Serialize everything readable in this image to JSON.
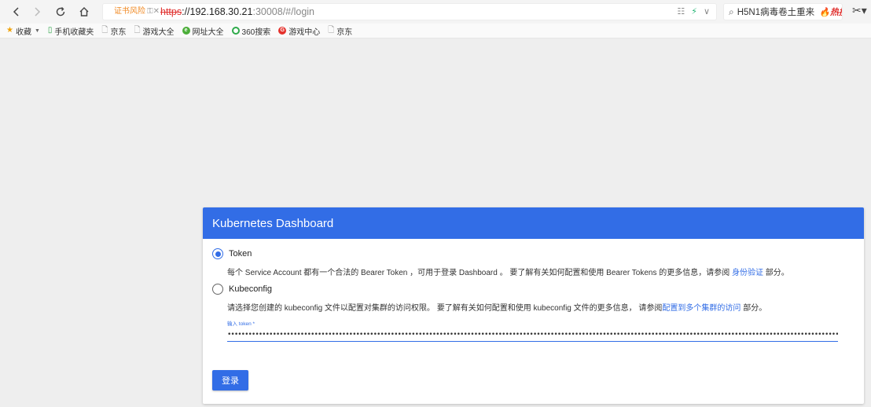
{
  "browser": {
    "cert_warning": "证书风险",
    "url_protocol": "https",
    "url_host": "://192.168.30.21",
    "url_path": ":30008/#/login",
    "search_text": "H5N1病毒卷土重来",
    "hot_badge": "热搜"
  },
  "bookmarks": {
    "items": [
      {
        "label": "收藏"
      },
      {
        "label": "手机收藏夹"
      },
      {
        "label": "京东"
      },
      {
        "label": "游戏大全"
      },
      {
        "label": "网址大全"
      },
      {
        "label": "360搜索"
      },
      {
        "label": "游戏中心"
      },
      {
        "label": "京东"
      }
    ]
  },
  "login": {
    "title": "Kubernetes Dashboard",
    "token_option": "Token",
    "token_desc_pre": "每个 Service Account 都有一个合法的 Bearer Token ，可用于登录 Dashboard 。 要了解有关如何配置和使用 Bearer Tokens 的更多信息，请参阅 ",
    "token_desc_link": "身份验证",
    "token_desc_post": " 部分。",
    "kubeconfig_option": "Kubeconfig",
    "kube_desc_pre": "请选择您创建的 kubeconfig 文件以配置对集群的访问权限。 要了解有关如何配置和使用 kubeconfig 文件的更多信息， 请参阅",
    "kube_desc_link": "配置到多个集群的访问",
    "kube_desc_post": " 部分。",
    "input_label": "输入 token *",
    "input_value": "••••••••••••••••••••••••••••••••••••••••••••••••••••••••••••••••••••••••••••••••••••••••••••••••••••••••••••••••••••••••••••••••••••••••••••••••••••••••••••••••••••••••••••••••••••••••••••",
    "submit_label": "登录"
  },
  "colors": {
    "primary": "#326de6",
    "background": "#eeeeee"
  }
}
